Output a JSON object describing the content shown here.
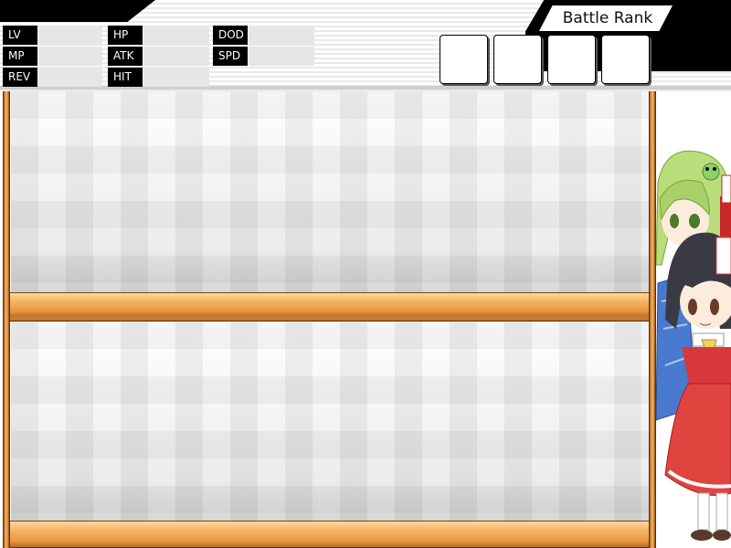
{
  "stats": {
    "col1": [
      {
        "label": "LV",
        "value": ""
      },
      {
        "label": "MP",
        "value": ""
      },
      {
        "label": "REV",
        "value": ""
      }
    ],
    "col2": [
      {
        "label": "HP",
        "value": ""
      },
      {
        "label": "ATK",
        "value": ""
      },
      {
        "label": "HIT",
        "value": ""
      }
    ],
    "col3": [
      {
        "label": "DOD",
        "value": ""
      },
      {
        "label": "SPD",
        "value": ""
      }
    ]
  },
  "battle_rank": {
    "title": "Battle Rank",
    "slots": [
      "",
      "",
      "",
      ""
    ]
  },
  "colors": {
    "wood": "#f4b463",
    "wood_dark": "#8a4a12",
    "header_black": "#000000",
    "stat_value_bg": "#e6e6e6"
  },
  "characters": [
    {
      "name": "green-haired-girl",
      "icon": "sanae-chibi"
    },
    {
      "name": "black-haired-shrine-maiden",
      "icon": "reimu-chibi"
    }
  ]
}
